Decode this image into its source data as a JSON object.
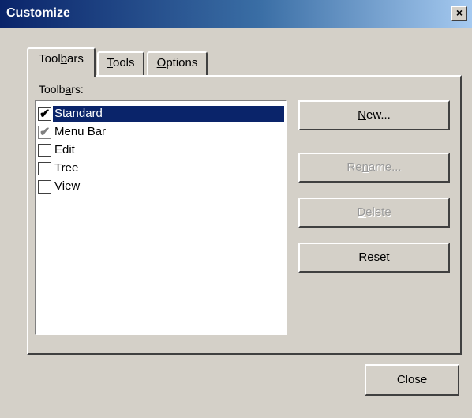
{
  "window": {
    "title": "Customize",
    "close_glyph": "×"
  },
  "tabs": [
    {
      "label_pre": "Tool",
      "label_ul": "b",
      "label_post": "ars",
      "active": true
    },
    {
      "label_pre": "",
      "label_ul": "T",
      "label_post": "ools",
      "active": false
    },
    {
      "label_pre": "",
      "label_ul": "O",
      "label_post": "ptions",
      "active": false
    }
  ],
  "toolbars_panel": {
    "label_pre": "Toolb",
    "label_ul": "a",
    "label_post": "rs:",
    "items": [
      {
        "label": "Standard",
        "checked": true,
        "disabled": false,
        "selected": true
      },
      {
        "label": "Menu Bar",
        "checked": true,
        "disabled": true,
        "selected": false
      },
      {
        "label": "Edit",
        "checked": false,
        "disabled": false,
        "selected": false
      },
      {
        "label": "Tree",
        "checked": false,
        "disabled": false,
        "selected": false
      },
      {
        "label": "View",
        "checked": false,
        "disabled": false,
        "selected": false
      }
    ],
    "buttons": {
      "new": {
        "ul": "N",
        "rest": "ew..."
      },
      "rename": {
        "pre": "Re",
        "ul": "n",
        "rest": "ame..."
      },
      "delete": {
        "ul": "D",
        "rest": "elete"
      },
      "reset": {
        "ul": "R",
        "rest": "eset"
      }
    }
  },
  "footer": {
    "close_label": "Close"
  },
  "check_glyph": "✔"
}
